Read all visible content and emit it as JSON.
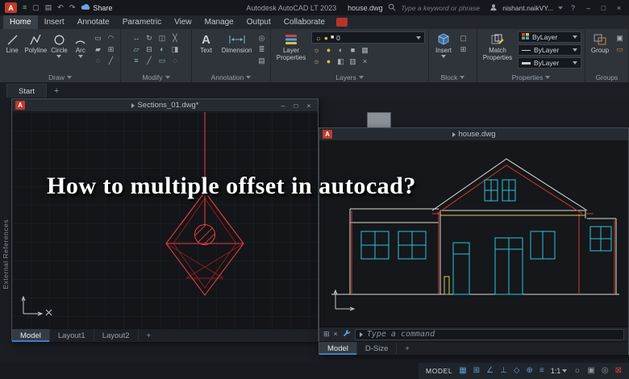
{
  "colors": {
    "autocad_red": "#c0392b",
    "active_tab": "#3a4047",
    "cad_line_red": "#e03c3c",
    "cad_cyan": "#29c5d8",
    "cad_yellow": "#d6c84e",
    "layout_highlight_blue": "#3d7dc4",
    "status_icon_blue": "#5b9bd5"
  },
  "titlebar": {
    "share_label": "Share",
    "app_title": "Autodesk AutoCAD LT 2023",
    "doc_title": "house.dwg",
    "search_placeholder": "Type a keyword or phrase",
    "user_name": "nishant.naikVY..."
  },
  "ribbon_tabs": {
    "items": [
      "Home",
      "Insert",
      "Annotate",
      "Parametric",
      "View",
      "Manage",
      "Output",
      "Collaborate"
    ]
  },
  "ribbon": {
    "draw": {
      "label": "Draw",
      "line": "Line",
      "polyline": "Polyline",
      "circle": "Circle",
      "arc": "Arc"
    },
    "modify": {
      "label": "Modify"
    },
    "annotation": {
      "label": "Annotation",
      "text": "Text",
      "dimension": "Dimension"
    },
    "layers": {
      "label": "Layers",
      "layer_properties": "Layer Properties",
      "current_layer": "0"
    },
    "block": {
      "label": "Block",
      "insert": "Insert"
    },
    "properties": {
      "label": "Properties",
      "match_properties": "Match Properties",
      "color_value": "ByLayer",
      "linetype_value": "ByLayer",
      "lineweight_value": "ByLayer"
    },
    "groups": {
      "label": "Groups",
      "group": "Group"
    }
  },
  "file_tabs": {
    "start": "Start",
    "add": "+"
  },
  "sections_window": {
    "title": "Sections_01.dwg*",
    "tabs": [
      "Model",
      "Layout1",
      "Layout2"
    ],
    "add_tab": "+"
  },
  "house_window": {
    "title": "house.dwg",
    "command_placeholder": "Type a command",
    "tabs": [
      "Model",
      "D-Size"
    ],
    "add_tab": "+"
  },
  "overlay": {
    "headline": "How to multiple offset in autocad?"
  },
  "side_panel": {
    "label": "External References"
  },
  "statusbar": {
    "model_label": "MODEL",
    "scale_label": "1:1"
  },
  "icons": {
    "app_menu": "≡",
    "new_file": "▢",
    "save": "▤",
    "undo": "↶",
    "redo": "↷",
    "minimize": "–",
    "maximize": "□",
    "close": "×",
    "help": "?",
    "text_tool": "A",
    "cmd_grid": "⊞",
    "cmd_close": "×",
    "sun": "☼",
    "bulb": "●",
    "swatch": "■",
    "draw_minis": [
      "▭",
      "◠",
      "▰",
      "⊞",
      "◌",
      "╱"
    ],
    "modify_minis": [
      "↔",
      "↻",
      "◫",
      "╳",
      "▱",
      "⊟",
      "◐",
      "◨",
      "≡",
      "╱",
      "▭",
      "◌"
    ],
    "annotation_minis": [
      "◎",
      "≣",
      "▤"
    ],
    "layer_minis": [
      "☼",
      "●",
      "◐",
      "■",
      "▦",
      "☼",
      "●",
      "◧",
      "▥",
      "×"
    ],
    "block_minis": [
      "▢",
      "⊞"
    ],
    "group_minis": [
      "▣",
      "▭"
    ],
    "statusbar_icons": [
      "▦",
      "⊞",
      "∠",
      "⊥",
      "◇",
      "⊕",
      "≡"
    ],
    "statusbar_icons2": [
      "☼",
      "▣",
      "◎"
    ],
    "clean_screen": "⊠"
  }
}
